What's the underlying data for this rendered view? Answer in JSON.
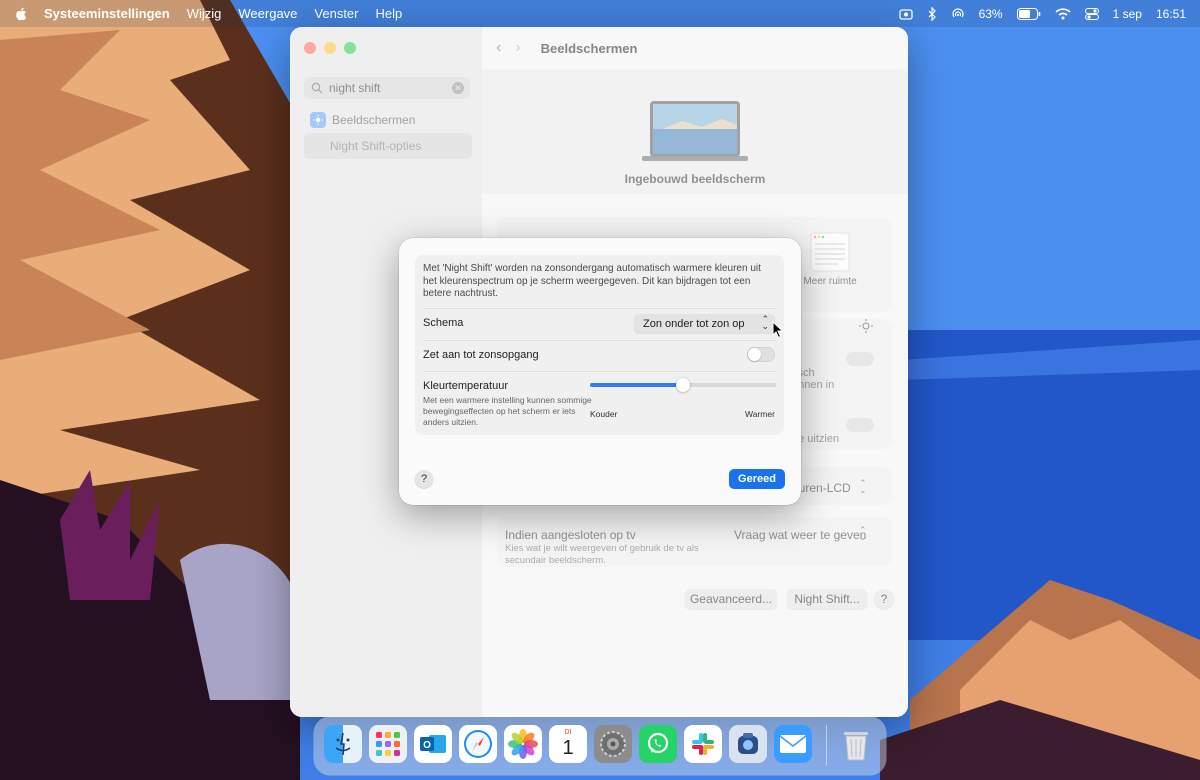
{
  "menubar": {
    "app_name": "Systeeminstellingen",
    "menus": [
      "Wijzig",
      "Weergave",
      "Venster",
      "Help"
    ],
    "battery_percent": "63%",
    "date": "1 sep",
    "time": "16:51"
  },
  "window": {
    "toolbar_title": "Beeldschermen",
    "search": {
      "value": "night shift"
    },
    "sidebar": {
      "items": [
        {
          "label": "Beeldschermen",
          "icon": "display-settings-icon"
        },
        {
          "label": "Night Shift-opties",
          "selected": true
        }
      ]
    },
    "hero_label": "Ingebouwd beeldscherm",
    "resolution_option_label": "Meer ruimte",
    "partial_texts": {
      "auto_brightness_1": "tisch",
      "auto_brightness_2": "unnen in",
      "true_tone_partial": "de uitzien",
      "preset_partial": "euren-LCD"
    },
    "tv": {
      "title": "Indien aangesloten op tv",
      "description": "Kies wat je wilt weergeven of gebruik de tv als secundair beeldscherm.",
      "select_value": "Vraag wat weer te geven"
    },
    "buttons": {
      "advanced": "Geavanceerd...",
      "night_shift": "Night Shift...",
      "help": "?"
    }
  },
  "dialog": {
    "description": "Met 'Night Shift' worden na zonsondergang automatisch warmere kleuren uit het kleurenspectrum op je scherm weergegeven. Dit kan bijdragen tot een betere nachtrust.",
    "schema": {
      "label": "Schema",
      "value": "Zon onder tot zon op"
    },
    "until_sunrise": {
      "label": "Zet aan tot zonsopgang",
      "on": false
    },
    "color_temp": {
      "label": "Kleurtemperatuur",
      "help": "Met een warmere instelling kunnen sommige bewegingseffecten op het scherm er iets anders uitzien.",
      "min_label": "Kouder",
      "max_label": "Warmer",
      "value_fraction": 0.5
    },
    "help_label": "?",
    "done_label": "Gereed"
  },
  "dock": {
    "calendar_month": "DI",
    "calendar_day": "1",
    "apps": [
      "finder-icon",
      "launchpad-icon",
      "outlook-icon",
      "safari-icon",
      "photos-icon",
      "calendar-icon",
      "system-settings-icon",
      "whatsapp-icon",
      "slack-icon",
      "screenium-icon",
      "mail-icon",
      "trash-icon"
    ]
  },
  "colors": {
    "accent": "#1a73e8",
    "sea": "#2f6ad8",
    "sky": "#3d7ee6"
  }
}
